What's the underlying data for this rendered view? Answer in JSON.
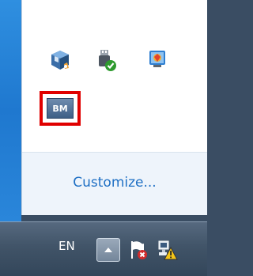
{
  "flyout": {
    "icons": [
      {
        "name": "virtualbox-icon"
      },
      {
        "name": "safely-remove-hardware-icon"
      },
      {
        "name": "network-share-icon"
      },
      {
        "name": "bm-app-icon",
        "label": "BM",
        "highlighted": true
      }
    ],
    "customize_label": "Customize...",
    "highlight_color": "#e00000"
  },
  "taskbar": {
    "language": "EN",
    "icons": [
      {
        "name": "show-hidden-icons-chevron-icon"
      },
      {
        "name": "action-center-flag-icon"
      },
      {
        "name": "network-warning-icon"
      }
    ]
  }
}
